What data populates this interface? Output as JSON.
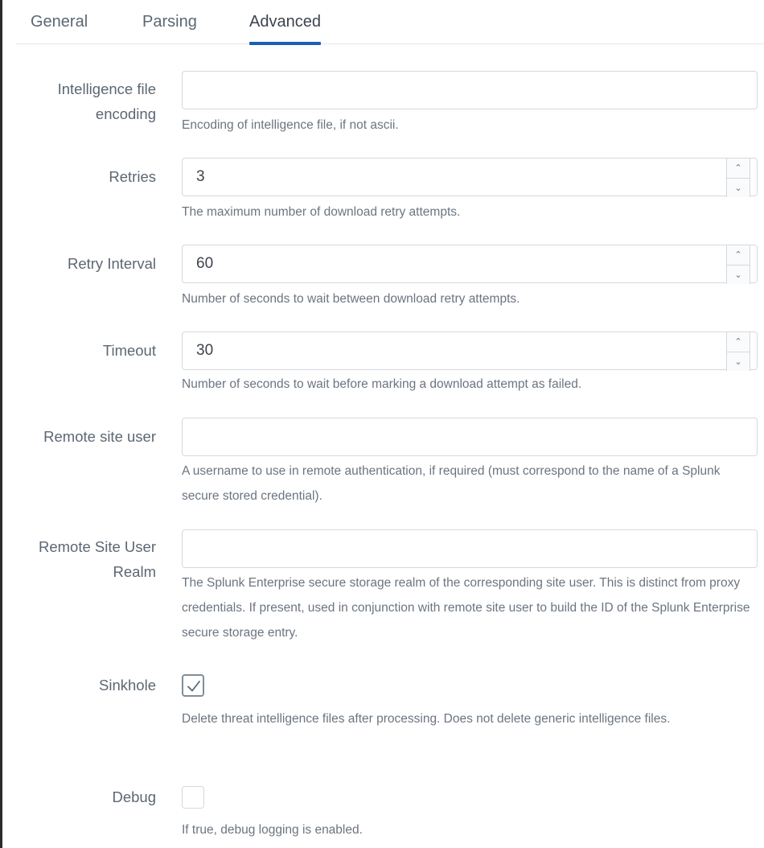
{
  "tabs": [
    {
      "label": "General",
      "active": false
    },
    {
      "label": "Parsing",
      "active": false
    },
    {
      "label": "Advanced",
      "active": true
    }
  ],
  "fields": {
    "encoding": {
      "label_line1": "Intelligence file",
      "label_line2": "encoding",
      "value": "",
      "help": "Encoding of intelligence file, if not ascii."
    },
    "retries": {
      "label": "Retries",
      "value": "3",
      "help": "The maximum number of download retry attempts.",
      "up_icon": "⌃",
      "down_icon": "⌄"
    },
    "retry_interval": {
      "label": "Retry Interval",
      "value": "60",
      "help": "Number of seconds to wait between download retry attempts.",
      "up_icon": "⌃",
      "down_icon": "⌄"
    },
    "timeout": {
      "label": "Timeout",
      "value": "30",
      "help": "Number of seconds to wait before marking a download attempt as failed.",
      "up_icon": "⌃",
      "down_icon": "⌄"
    },
    "remote_site_user": {
      "label": "Remote site user",
      "value": "",
      "help": "A username to use in remote authentication, if required (must correspond to the name of a Splunk secure stored credential)."
    },
    "remote_site_user_realm": {
      "label_line1": "Remote Site User",
      "label_line2": "Realm",
      "value": "",
      "help": "The Splunk Enterprise secure storage realm of the corresponding site user. This is distinct from proxy credentials. If present, used in conjunction with remote site user to build the ID of the Splunk Enterprise secure storage entry."
    },
    "sinkhole": {
      "label": "Sinkhole",
      "checked": true,
      "help": "Delete threat intelligence files after processing. Does not delete generic intelligence files."
    },
    "debug": {
      "label": "Debug",
      "checked": false,
      "help": "If true, debug logging is enabled."
    }
  },
  "colors": {
    "accent": "#1a5fb4",
    "label": "#5c6773",
    "help_text": "#6b7580",
    "border": "#d5d8dc"
  }
}
